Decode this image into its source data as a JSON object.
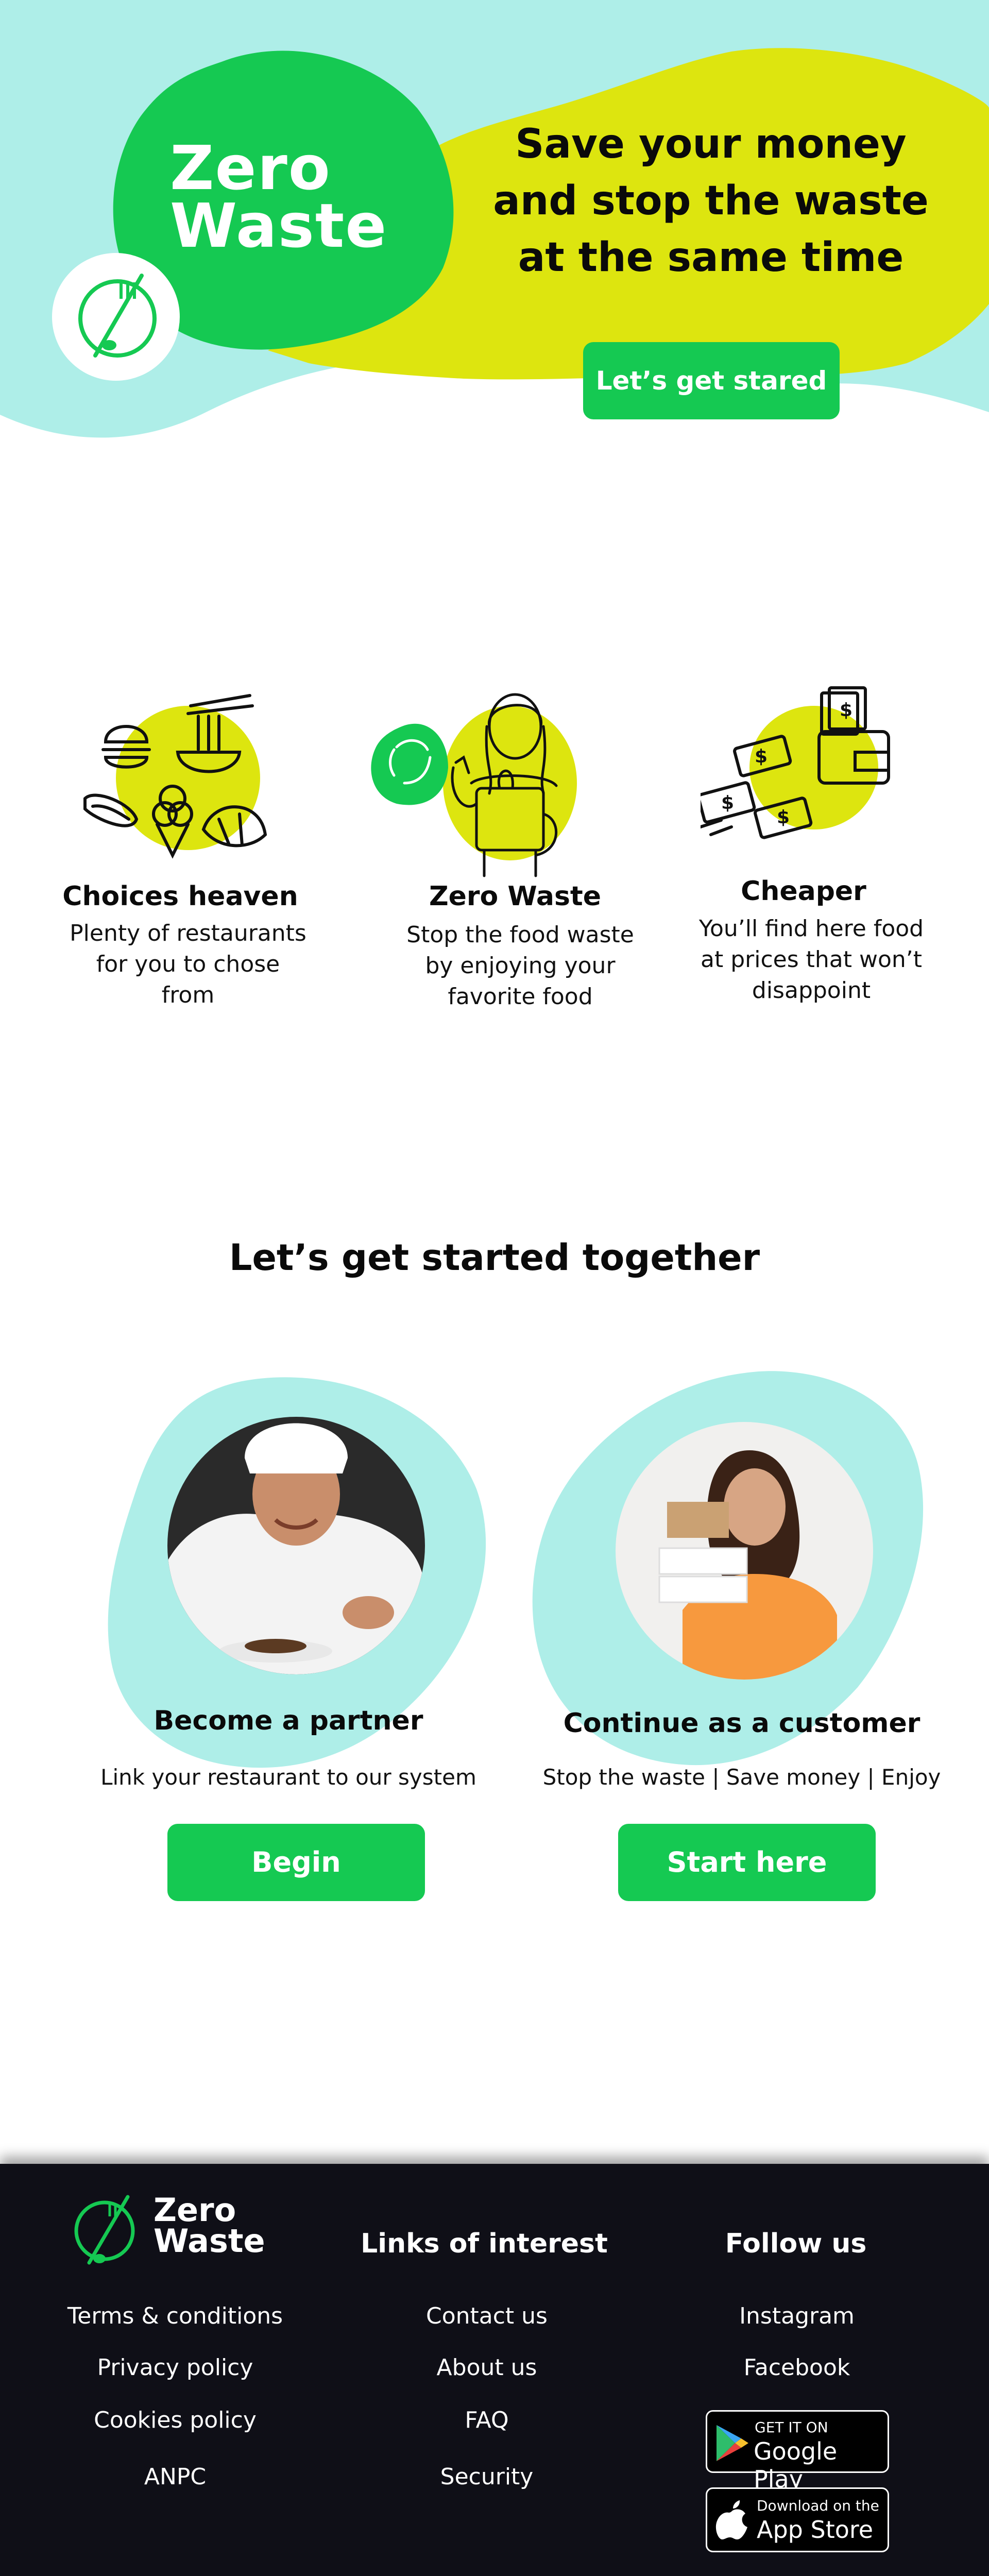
{
  "hero": {
    "logo_line1": "Zero",
    "logo_line2": "Waste",
    "headline_line1": "Save your money",
    "headline_line2": "and stop the waste",
    "headline_line3": "at the same time",
    "cta_label": "Let’s get stared"
  },
  "features": [
    {
      "title": "Choices heaven",
      "desc": [
        "Plenty of restaurants",
        "for you to chose",
        "from"
      ],
      "icon": "food-icons"
    },
    {
      "title": "Zero Waste",
      "desc": [
        "Stop the food waste",
        "by enjoying your",
        "favorite food"
      ],
      "icon": "woman-grocery-icon"
    },
    {
      "title": "Cheaper",
      "desc": [
        "You’ll find here food",
        "at prices that won’t",
        "disappoint"
      ],
      "icon": "wallet-money-icon"
    }
  ],
  "get_started": {
    "title": "Let’s get started together",
    "partner": {
      "title": "Become a partner",
      "desc": "Link your restaurant to our system",
      "button": "Begin"
    },
    "customer": {
      "title": "Continue as a customer",
      "desc": "Stop the waste | Save money | Enjoy",
      "button": "Start here"
    }
  },
  "footer": {
    "logo_line1": "Zero",
    "logo_line2": "Waste",
    "links_heading": "Links of interest",
    "follow_heading": "Follow us",
    "col1": [
      "Terms & conditions",
      "Privacy policy",
      "Cookies policy",
      "ANPC"
    ],
    "col2": [
      "Contact us",
      "About us",
      "FAQ",
      "Security"
    ],
    "social": [
      "Instagram",
      "Facebook"
    ],
    "google_small": "GET IT ON",
    "google_big": "Google Play",
    "apple_small": "Download on the",
    "apple_big": "App Store"
  },
  "colors": {
    "aqua": "#aeeee8",
    "green": "#15c952",
    "yellow": "#dde50f",
    "footer_bg": "#0f0f17"
  }
}
